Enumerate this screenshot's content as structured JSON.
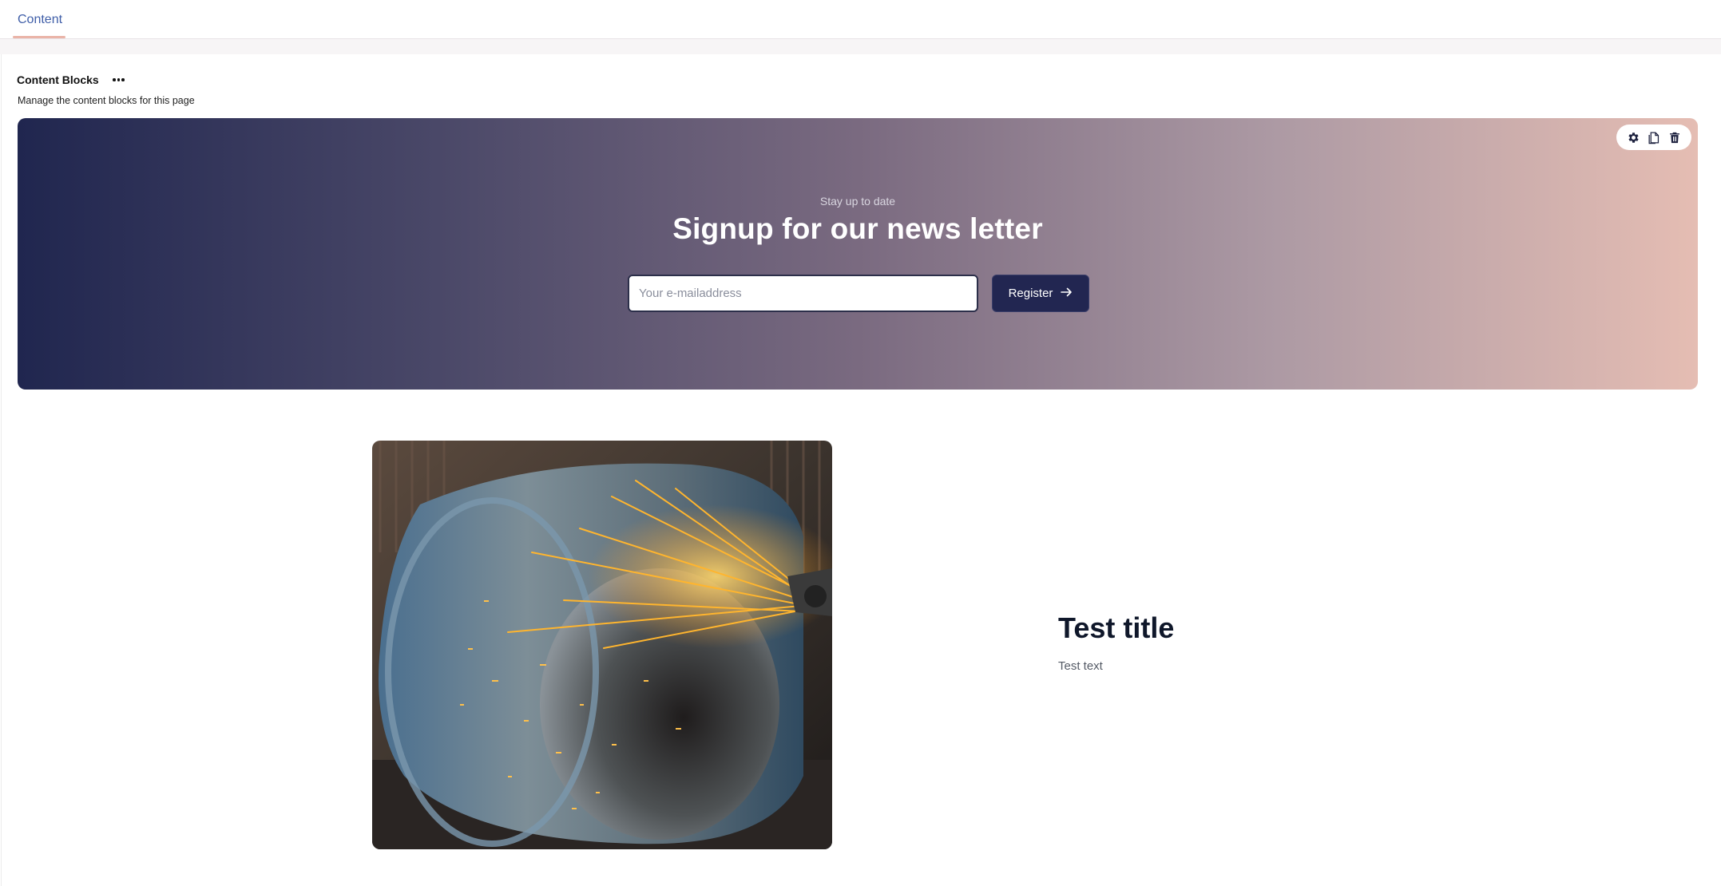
{
  "tabs": [
    {
      "label": "Content",
      "active": true
    }
  ],
  "section": {
    "title": "Content Blocks",
    "description": "Manage the content blocks for this page"
  },
  "newsletter": {
    "kicker": "Stay up to date",
    "title": "Signup for our news letter",
    "input_placeholder": "Your e-mailaddress",
    "button_label": "Register",
    "gradient_start": "#20264f",
    "gradient_end": "#e5bdb3",
    "tools": [
      "gear-icon",
      "duplicate-icon",
      "trash-icon"
    ]
  },
  "media_block": {
    "image_subject": "angle grinder sparks inside large steel cylinder",
    "title": "Test title",
    "text": "Test text"
  },
  "colors": {
    "accent": "#3f5ea8",
    "tab_underline": "#eab4a8",
    "button_bg": "#222651"
  }
}
